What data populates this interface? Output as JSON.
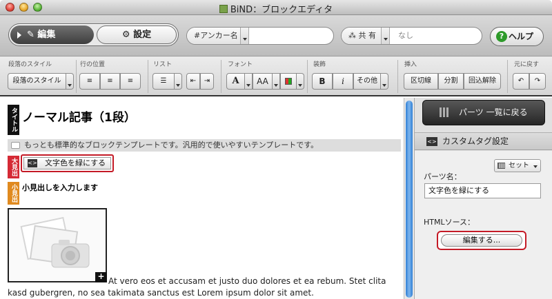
{
  "window": {
    "title": "BiND：ブロックエディタ"
  },
  "toolbar": {
    "edit_label": "編集",
    "settings_label": "設定",
    "anchor": {
      "label": "#アンカー名",
      "value": ""
    },
    "share": {
      "label": "共 有",
      "value": "なし"
    },
    "help_label": "ヘルプ"
  },
  "format_bar": {
    "groups": {
      "paragraph_style": "段落のスタイル",
      "line_position": "行の位置",
      "list": "リスト",
      "font": "フォント",
      "decoration": "装飾",
      "insert": "挿入",
      "undo_group": "元に戻す"
    },
    "buttons": {
      "paragraph_style": "段落のスタイル",
      "font_a": "A",
      "font_size": "AA",
      "bold": "B",
      "italic": "i",
      "other": "その他",
      "divider": "区切線",
      "split": "分割",
      "wrap_release": "回込解除"
    }
  },
  "editor": {
    "tags": {
      "title": "タイトル",
      "big_heading": "大見出",
      "small_heading": "小見出"
    },
    "heading": "ノーマル記事（1段）",
    "note": "もっとも標準的なブロックテンプレートです。汎用的で使いやすいテンプレートです。",
    "custom_tag_button": "文字色を緑にする",
    "subheading": "小見出しを入力します",
    "image_add": "+",
    "body_line1": "At vero eos et accusam et justo duo dolores et ea rebum. Stet clita",
    "body_line2": "kasd gubergren, no sea takimata sanctus est Lorem ipsum dolor sit amet."
  },
  "panel": {
    "parts_list_button": "パーツ 一覧に戻る",
    "header_title": "カスタムタグ設定",
    "parts_name_label": "パーツ名：",
    "set_button": "セット",
    "parts_name_value": "文字色を緑にする",
    "html_source_label": "HTMLソース：",
    "edit_button": "編集する..."
  },
  "colors": {
    "accent_red": "#c41a26",
    "tag_black": "#111111",
    "tag_red": "#d52a35",
    "tag_orange": "#e08a1f",
    "help_green": "#2d9a2a"
  }
}
